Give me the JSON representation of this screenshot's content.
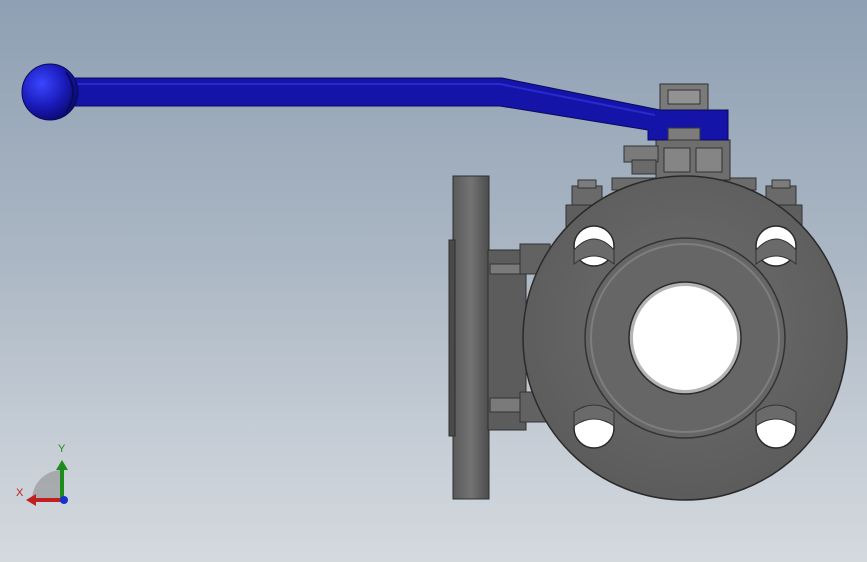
{
  "triad": {
    "x_label": "X",
    "y_label": "Y",
    "x_color": "#c0201f",
    "y_color": "#1d8c1d",
    "z_color": "#1a2fd0"
  },
  "colors": {
    "handle": "#1414a8",
    "handle_knob": "#2222c8",
    "steel_dark": "#505050",
    "steel_mid": "#6b6b6b",
    "steel_light": "#8c8c8c",
    "bore_white": "#ffffff"
  }
}
